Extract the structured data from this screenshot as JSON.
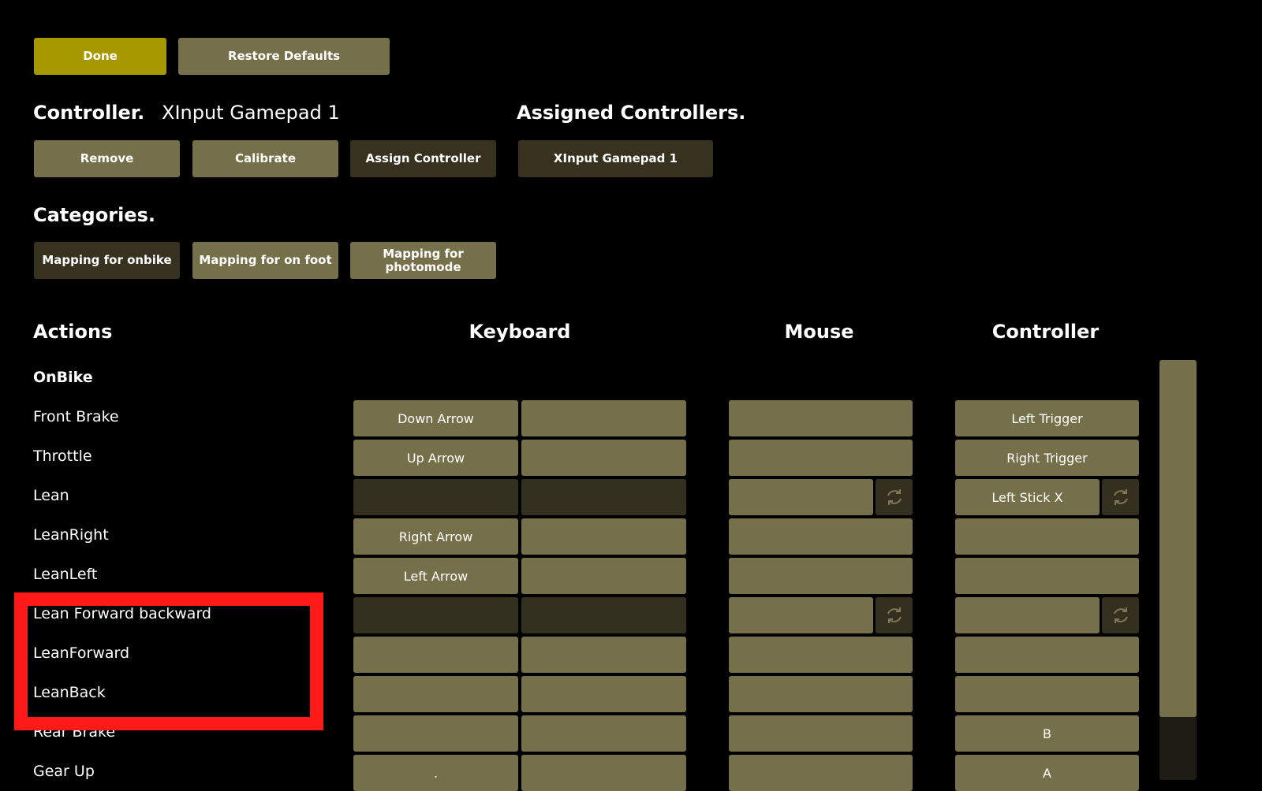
{
  "toolbar": {
    "done_label": "Done",
    "restore_label": "Restore Defaults"
  },
  "controller": {
    "heading": "Controller.",
    "name": "XInput Gamepad 1",
    "remove_label": "Remove",
    "calibrate_label": "Calibrate",
    "assign_label": "Assign Controller"
  },
  "assigned": {
    "heading": "Assigned Controllers.",
    "items": [
      "XInput Gamepad 1"
    ]
  },
  "categories": {
    "heading": "Categories.",
    "items": [
      "Mapping for onbike",
      "Mapping for on foot",
      "Mapping for photomode"
    ]
  },
  "columns": {
    "actions": "Actions",
    "keyboard": "Keyboard",
    "mouse": "Mouse",
    "controller": "Controller"
  },
  "group_label": "OnBike",
  "rows": [
    {
      "label": "Front Brake",
      "key1": "Down Arrow",
      "key2": "",
      "mouse": "",
      "controller": "Left Trigger"
    },
    {
      "label": "Throttle",
      "key1": "Up Arrow",
      "key2": "",
      "mouse": "",
      "controller": "Right Trigger"
    },
    {
      "label": "Lean",
      "key1": "",
      "key2": "",
      "mouse": "",
      "controller": "Left Stick X"
    },
    {
      "label": "LeanRight",
      "key1": "Right Arrow",
      "key2": "",
      "mouse": "",
      "controller": ""
    },
    {
      "label": "LeanLeft",
      "key1": "Left Arrow",
      "key2": "",
      "mouse": "",
      "controller": ""
    },
    {
      "label": "Lean Forward backward",
      "key1": "",
      "key2": "",
      "mouse": "",
      "controller": ""
    },
    {
      "label": "LeanForward",
      "key1": "",
      "key2": "",
      "mouse": "",
      "controller": ""
    },
    {
      "label": "LeanBack",
      "key1": "",
      "key2": "",
      "mouse": "",
      "controller": ""
    },
    {
      "label": "Rear Brake",
      "key1": "",
      "key2": "",
      "mouse": "",
      "controller": "B"
    },
    {
      "label": "Gear Up",
      "key1": ".",
      "key2": "",
      "mouse": "",
      "controller": "A"
    }
  ],
  "icons": {
    "reverse": "reverse-axis-icon"
  },
  "colors": {
    "accent": "#a89800",
    "button": "#76704a",
    "button_dark": "#37321f",
    "highlight": "#ff1a1a"
  }
}
